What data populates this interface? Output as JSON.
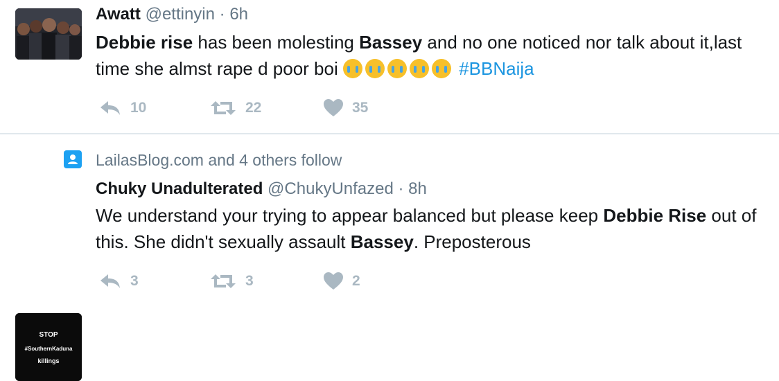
{
  "tweets": [
    {
      "name": "Awatt",
      "handle": "@ettinyin",
      "separator": "·",
      "time": "6h",
      "text": {
        "b1": "Debbie rise",
        "t1": " has been molesting ",
        "b2": "Bassey",
        "t2": " and no one noticed nor talk about it,last time she almst rape d poor boi ",
        "emoji": "loudly-crying-face",
        "emoji_count": 5,
        "hashtag": "#BBNaija"
      },
      "reply_count": "10",
      "retweet_count": "22",
      "like_count": "35"
    },
    {
      "context": "LailasBlog.com and 4 others follow",
      "name": "Chuky Unadulterated",
      "handle": "@ChukyUnfazed",
      "separator": "·",
      "time": "8h",
      "avatar_text": {
        "line1": "STOP",
        "line2": "#SouthernKaduna",
        "line3": "killings"
      },
      "text": {
        "t1": "We understand your trying to appear balanced  but please keep ",
        "b1": "Debbie Rise",
        "t2": " out of this. She didn't sexually assault ",
        "b2": "Bassey",
        "t3": ". Preposterous"
      },
      "reply_count": "3",
      "retweet_count": "3",
      "like_count": "2"
    }
  ],
  "colors": {
    "link": "#1b95e0",
    "muted": "#657786",
    "action_gray": "#aab8c2",
    "divider": "#e1e8ed"
  }
}
